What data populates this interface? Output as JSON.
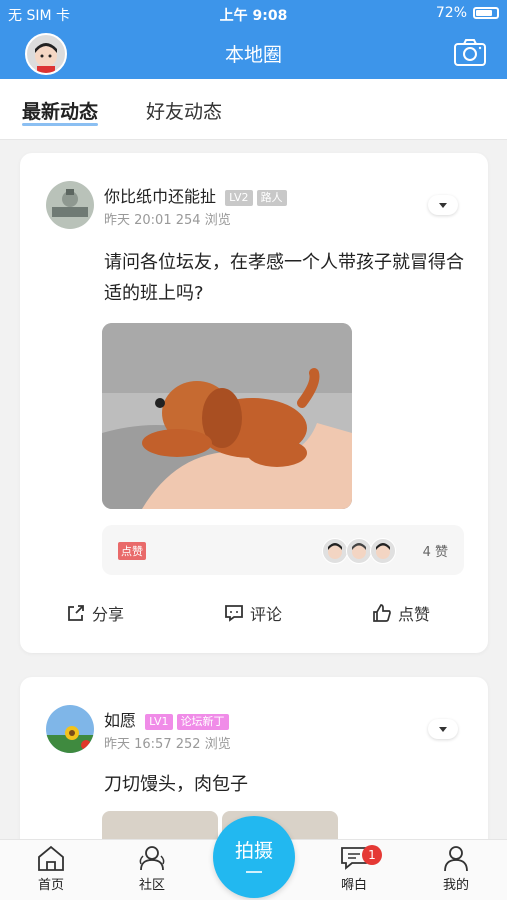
{
  "status": {
    "carrier": "无 SIM 卡",
    "time": "上午 9:08",
    "battery": "72%"
  },
  "topbar": {
    "title": "本地圈"
  },
  "tabs": [
    {
      "label": "最新动态"
    },
    {
      "label": "好友动态"
    }
  ],
  "posts": [
    {
      "username": "你比纸巾还能扯",
      "level": "LV2",
      "role": "路人",
      "time": "昨天 20:01",
      "views": "254 浏览",
      "text": "请问各位坛友，在孝感一个人带孩子就冒得合适的班上吗?",
      "like_tag": "点赞",
      "like_count": "4 赞",
      "actions": {
        "share": "分享",
        "comment": "评论",
        "like": "点赞"
      }
    },
    {
      "username": "如愿",
      "level": "LV1",
      "role": "论坛新丁",
      "time": "昨天 16:57",
      "views": "252 浏览",
      "text": "刀切馒头，肉包子"
    }
  ],
  "tabbar": {
    "home": "首页",
    "community": "社区",
    "shoot": "拍摄",
    "chat": "嘚白",
    "chat_badge": "1",
    "mine": "我的"
  },
  "colors": {
    "accent": "#3d95ea",
    "shoot": "#22b8f0",
    "badge_red": "#e53935"
  }
}
